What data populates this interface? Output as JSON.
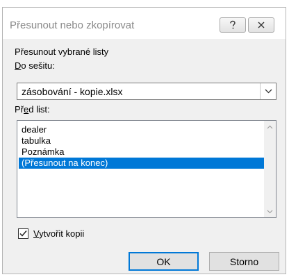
{
  "dialog": {
    "title": "Přesunout nebo zkopírovat",
    "help_icon": "question-mark-icon",
    "close_icon": "close-x-icon"
  },
  "move_selected_label": "Přesunout vybrané listy",
  "workbook": {
    "label_underlined": "D",
    "label_rest": "o sešitu:",
    "selected_value": "zásobování - kopie.xlsx"
  },
  "before_sheet": {
    "label_prefix": "Př",
    "label_underlined": "e",
    "label_rest": "d list:",
    "items": [
      {
        "label": "dealer",
        "selected": false
      },
      {
        "label": "tabulka",
        "selected": false
      },
      {
        "label": "Poznámka",
        "selected": false
      },
      {
        "label": "(Přesunout na konec)",
        "selected": true
      }
    ]
  },
  "create_copy": {
    "label_underlined": "V",
    "label_rest": "ytvořit kopii",
    "checked": true
  },
  "buttons": {
    "ok_label": "OK",
    "cancel_label": "Storno"
  },
  "colors": {
    "selection": "#0078d7",
    "dialog_bg": "#f0f0f0"
  }
}
